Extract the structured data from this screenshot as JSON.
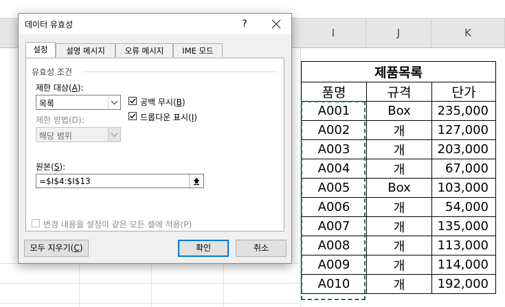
{
  "spreadsheet": {
    "columns": [
      "I",
      "J",
      "K"
    ],
    "table": {
      "title": "제품목록",
      "headers": [
        "품명",
        "규격",
        "단가"
      ],
      "rows": [
        [
          "A001",
          "Box",
          "235,000"
        ],
        [
          "A002",
          "개",
          "127,000"
        ],
        [
          "A003",
          "개",
          "203,000"
        ],
        [
          "A004",
          "개",
          "67,000"
        ],
        [
          "A005",
          "Box",
          "103,000"
        ],
        [
          "A006",
          "개",
          "54,000"
        ],
        [
          "A007",
          "개",
          "135,000"
        ],
        [
          "A008",
          "개",
          "113,000"
        ],
        [
          "A009",
          "개",
          "114,000"
        ],
        [
          "A010",
          "개",
          "192,000"
        ]
      ]
    },
    "copy_marquee_color": "#217346"
  },
  "dialog": {
    "title": "데이터 유효성",
    "help": "?",
    "tabs": [
      "설정",
      "설명 메시지",
      "오류 메시지",
      "IME 모드"
    ],
    "active_tab": "설정",
    "group_label": "유효성 조건",
    "allow_label_pre": "제한 대상(",
    "allow_label_key": "A",
    "allow_label_post": "):",
    "allow_value": "목록",
    "data_label": "제한 방법(D):",
    "data_value": "해당 범위",
    "ignore_blank": {
      "label_pre": "공백 무시(",
      "key": "B",
      "label_post": ")",
      "checked": true
    },
    "dropdown": {
      "label_pre": "드롭다운 표시(",
      "key": "I",
      "label_post": ")",
      "checked": true
    },
    "source_label_pre": "원본(",
    "source_label_key": "S",
    "source_label_post": "):",
    "source_value": "=$I$4:$I$13",
    "apply_all": {
      "label": "변경 내용을 설정이 같은 모든 셀에 적용(P)",
      "checked": false
    },
    "clear_all_pre": "모두 지우기(",
    "clear_all_key": "C",
    "clear_all_post": ")",
    "ok": "확인",
    "cancel": "취소",
    "accent_color": "#0078d7"
  }
}
